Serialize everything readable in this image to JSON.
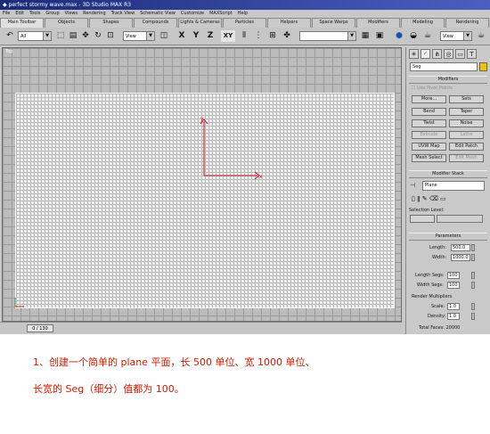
{
  "window": {
    "title": "perfect stormy wave.max - 3D Studio MAX R3"
  },
  "menu": [
    "File",
    "Edit",
    "Tools",
    "Group",
    "Views",
    "Rendering",
    "Track View",
    "Schematic View",
    "Customize",
    "MAXScript",
    "Help"
  ],
  "tabs": [
    {
      "label": "Main Toolbar",
      "active": true
    },
    {
      "label": "Objects"
    },
    {
      "label": "Shapes"
    },
    {
      "label": "Compounds"
    },
    {
      "label": "Lights & Cameras"
    },
    {
      "label": "Particles"
    },
    {
      "label": "Helpers"
    },
    {
      "label": "Space Warps"
    },
    {
      "label": "Modifiers"
    },
    {
      "label": "Modeling"
    },
    {
      "label": "Rendering"
    }
  ],
  "toolbar": {
    "selection_filter": "All",
    "ref_coord": "View",
    "axis_x": "X",
    "axis_y": "Y",
    "axis_z": "Z",
    "axis_xy": "XY",
    "view_combo_right": "View"
  },
  "viewport": {
    "label": "Top"
  },
  "status": {
    "time_slider": "0 / 130"
  },
  "command_panel": {
    "object_name": "Seg",
    "modifiers": {
      "header": "Modifiers",
      "use_pivot_points": "Use Pivot Points",
      "more": "More...",
      "sets": "Sets",
      "buttons": [
        "Bend",
        "Taper",
        "Twist",
        "Noise",
        "Extrude",
        "Lathe",
        "UVW Map",
        "Edit Patch",
        "Mesh Select",
        "Edit Mesh"
      ]
    },
    "modifier_stack": {
      "header": "Modifier Stack",
      "current": "Plane",
      "selection_level": "Selection Level:"
    },
    "parameters": {
      "header": "Parameters",
      "length_label": "Length:",
      "length_value": "500.0",
      "width_label": "Width:",
      "width_value": "1000.0",
      "length_segs_label": "Length Segs:",
      "length_segs_value": "100",
      "width_segs_label": "Width Segs:",
      "width_segs_value": "100",
      "render_multipliers": "Render Multipliers",
      "scale_label": "Scale:",
      "scale_value": "1.0",
      "density_label": "Density:",
      "density_value": "1.0",
      "total_faces": "Total Faces: 20000"
    }
  },
  "caption": {
    "line1": "1、创建一个简单的 plane 平面，长 500 单位、宽 1000 单位、",
    "line2": "长宽的 Seg（细分）值都为 100。"
  },
  "colors": {
    "caption": "#cc1b00",
    "title_bar": "#1d2a7a",
    "axis": "#c0182a"
  }
}
